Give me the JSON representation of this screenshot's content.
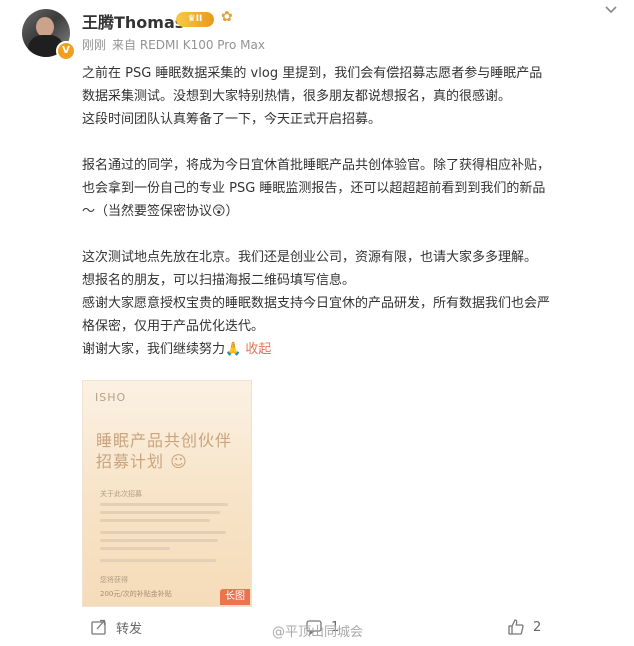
{
  "post": {
    "author": "王腾Thomas",
    "vip_level": "II",
    "time": "刚刚",
    "source": "来自 REDMI K100 Pro Max",
    "paragraphs": [
      [
        "之前在 PSG 睡眠数据采集的 vlog 里提到，我们会有偿招募志愿者参与睡眠产品",
        "数据采集测试。没想到大家特别热情，很多朋友都说想报名，真的很感谢。",
        "这段时间团队认真筹备了一下，今天正式开启招募。"
      ],
      [
        "报名通过的同学，将成为今日宜休首批睡眠产品共创体验官。除了获得相应补贴，",
        "也会拿到一份自己的专业 PSG 睡眠监测报告，还可以超超超前看到到我们的新品",
        "～（当然要签保密协议😲）"
      ],
      [
        "这次测试地点先放在北京。我们还是创业公司，资源有限，也请大家多多理解。",
        "想报名的朋友，可以扫描海报二维码填写信息。",
        "感谢大家愿意授权宝贵的睡眠数据支持今日宜休的产品研发，所有数据我们也会严",
        "格保密，仅用于产品优化迭代。"
      ]
    ],
    "closing": "谢谢大家，我们继续努力🙏",
    "collapse_label": "收起"
  },
  "poster": {
    "brand": "ISHO",
    "title_line1": "睡眠产品共创伙伴",
    "title_line2": "招募计划 ☺",
    "section1": "关于此次招募",
    "section2": "您将获得",
    "reward_line": "200元/次的补贴金补贴",
    "long_image_tag": "长图"
  },
  "actions": {
    "repost_label": "转发",
    "comment_count": "1",
    "like_count": "2"
  },
  "watermark": "@平顶山同城会",
  "colors": {
    "accent": "#eb7350",
    "vip_gold": "#e79a1f",
    "meta_gray": "#939393"
  }
}
